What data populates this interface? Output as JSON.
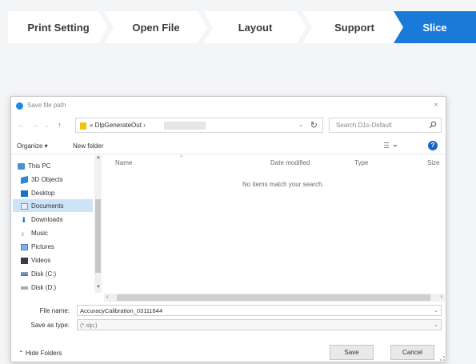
{
  "steps": [
    {
      "label": "Print Setting",
      "active": false
    },
    {
      "label": "Open File",
      "active": false
    },
    {
      "label": "Layout",
      "active": false
    },
    {
      "label": "Support",
      "active": false
    },
    {
      "label": "Slice",
      "active": true
    }
  ],
  "colors": {
    "active_step": "#1a7ad9",
    "inactive_step": "#ffffff",
    "accent": "#1a66c7",
    "selected_nav": "#cde3f7"
  },
  "dialog": {
    "title": "Save file path",
    "close_label": "×",
    "address": {
      "path_text": "«  DlpGenerateOut  ›"
    },
    "search_placeholder": "Search D1s-Default",
    "toolbar": {
      "organize": "Organize ▾",
      "new_folder": "New folder",
      "help": "?"
    },
    "nav_items": [
      {
        "label": "This PC",
        "icon": "this-pc-icon"
      },
      {
        "label": "3D Objects",
        "icon": "3d-objects-icon"
      },
      {
        "label": "Desktop",
        "icon": "desktop-icon"
      },
      {
        "label": "Documents",
        "icon": "documents-icon"
      },
      {
        "label": "Downloads",
        "icon": "downloads-icon"
      },
      {
        "label": "Music",
        "icon": "music-icon"
      },
      {
        "label": "Pictures",
        "icon": "pictures-icon"
      },
      {
        "label": "Videos",
        "icon": "videos-icon"
      },
      {
        "label": "Disk (C:)",
        "icon": "disk-c-icon"
      },
      {
        "label": "Disk (D:)",
        "icon": "disk-d-icon"
      }
    ],
    "columns": [
      "Name",
      "Date modified",
      "Type",
      "Size"
    ],
    "empty_message": "No items match your search.",
    "file_name_label": "File name:",
    "file_name_value": "AccuracyCalibration_03111644",
    "save_type_label": "Save as type:",
    "save_type_value": "(*.slp;)",
    "hide_folders": "Hide Folders",
    "save_button": "Save",
    "cancel_button": "Cancel"
  }
}
